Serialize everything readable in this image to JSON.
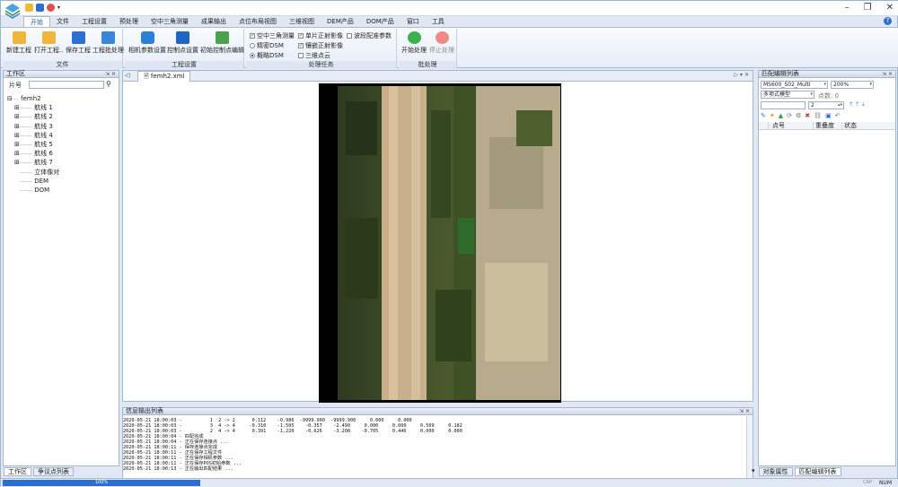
{
  "menu": [
    "开始",
    "文件",
    "工程设置",
    "预处理",
    "空中三角测量",
    "成果输出",
    "点位布局视图",
    "三维视图",
    "DEM产品",
    "DOM产品",
    "窗口",
    "工具"
  ],
  "ribbon": {
    "file_group": {
      "title": "文件",
      "buttons": [
        "新建工程",
        "打开工程..",
        "保存工程",
        "工程批处理"
      ]
    },
    "settings_group": {
      "title": "工程设置",
      "buttons": [
        "相机参数设置",
        "控制点设置",
        "初始控制点编辑"
      ]
    },
    "process_group": {
      "title": "处理任务",
      "checks": [
        "空中三角测量",
        "单片正射影像",
        "波段配准参数",
        "镶嵌正射影像",
        "三维点云"
      ],
      "radios": [
        "精密DSM",
        "概略DSM"
      ]
    },
    "batch_group": {
      "title": "批处理",
      "buttons": [
        "开始处理",
        "停止处理"
      ]
    }
  },
  "workspace": {
    "title": "工作区",
    "search_label": "片号",
    "search_value": "",
    "tree": {
      "root": "femh2",
      "children": [
        "航线 1",
        "航线 2",
        "航线 3",
        "航线 4",
        "航线 5",
        "航线 6",
        "航线 7",
        "立体像对",
        "DEM",
        "DOM"
      ]
    },
    "bottom_tabs": [
      "工作区",
      "争议点列表"
    ]
  },
  "document": {
    "tab": "femh2.xml"
  },
  "output": {
    "title": "信息输出列表",
    "lines": [
      "2020-05-21 18:00:03 -          1  2 -> 2      0.112    -0.986  -9999.900  -9999.900     0.000     0.000",
      "2020-05-21 18:00:03 -          3  4 -> 4     -0.310    -1.505    -0.357    -2.490     0.000     0.000     0.509     0.182",
      "2020-05-21 18:00:03 -          2  4 -> 4      0.391    -1.220    -0.626    -3.208    -0.705     0.446     0.000     0.000",
      "2020-05-21 18:00:04 - 匹配完成",
      "2020-05-21 18:00:04 - 正在保存连接点 ...",
      "2020-05-21 18:00:11 - 保存连接点完成",
      "2020-05-21 18:00:11 - 正在保存工程文件",
      "2020-05-21 18:00:11 - 正在保存相机参数 ...",
      "2020-05-21 18:00:11 - 正在保存POS初始参数 ...",
      "2020-05-21 18:00:13 - 正在输出匹配结果 ..."
    ]
  },
  "matchpanel": {
    "title": "匹配编辑列表",
    "image_select": "MS600_S02_Multi",
    "zoom_select": "200%",
    "model_select": "多项式模型",
    "points_label": "点数: 0",
    "spin_value": "2",
    "columns": [
      "点号",
      "重叠度",
      "状态"
    ],
    "bottom_tabs": [
      "对象属性",
      "匹配编辑列表"
    ]
  },
  "status": {
    "progress": "100%",
    "num": "NUM"
  }
}
